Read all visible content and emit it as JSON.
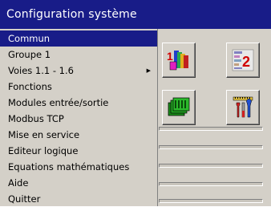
{
  "window": {
    "title": "Configuration système"
  },
  "menu": {
    "items": [
      {
        "label": "Commun",
        "active": true
      },
      {
        "label": "Groupe 1"
      },
      {
        "label": "Voies 1.1 - 1.6",
        "submenu": true
      },
      {
        "label": "Fonctions"
      },
      {
        "label": "Modules entrée/sortie"
      },
      {
        "label": "Modbus TCP"
      },
      {
        "label": "Mise en service"
      },
      {
        "label": "Editeur logique"
      },
      {
        "label": "Equations mathématiques"
      },
      {
        "label": "Aide"
      },
      {
        "label": "Quitter"
      }
    ]
  },
  "toolbar": {
    "icons": [
      {
        "name": "channel-1-icon",
        "digit": "1"
      },
      {
        "name": "group-2-icon",
        "digit": "2"
      },
      {
        "name": "io-modules-icon"
      },
      {
        "name": "tools-icon"
      }
    ]
  },
  "colors": {
    "title_bg": "#181c88",
    "menu_bg": "#d4d0c8",
    "highlight": "#181c88"
  }
}
